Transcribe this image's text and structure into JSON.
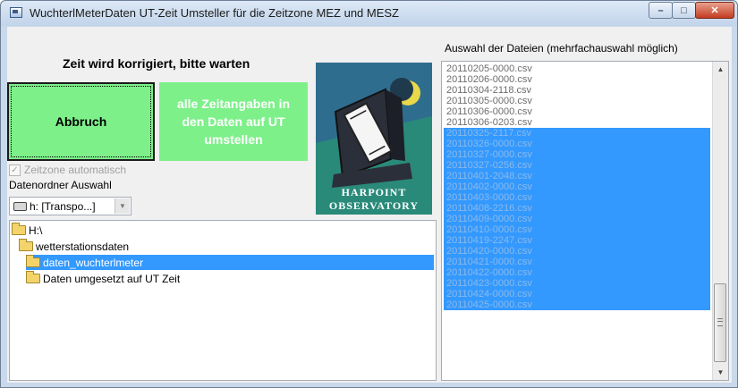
{
  "window": {
    "title": "WuchterlMeterDaten UT-Zeit Umsteller für die Zeitzone MEZ und MESZ",
    "min_label": "–",
    "max_label": "□",
    "close_label": "✕"
  },
  "status": {
    "text": "Zeit wird korrigiert, bitte warten"
  },
  "buttons": {
    "abort_label": "Abbruch",
    "convert_label": "alle Zeitangaben in den Daten auf UT umstellen"
  },
  "timezone_checkbox": {
    "label": "Zeitzone automatisch",
    "checked": true
  },
  "folder": {
    "label": "Datenordner Auswahl",
    "drive_value": "h: [Transpo...]"
  },
  "logo": {
    "line1": "HARPOINT",
    "line2": "OBSERVATORY"
  },
  "directory_tree": [
    {
      "label": "H:\\",
      "selected": false
    },
    {
      "label": "wetterstationsdaten",
      "selected": false
    },
    {
      "label": "daten_wuchterlmeter",
      "selected": true
    },
    {
      "label": "Daten umgesetzt auf UT Zeit",
      "selected": false
    }
  ],
  "files": {
    "label": "Auswahl der Dateien  (mehrfachauswahl möglich)",
    "items": [
      {
        "name": "20110205-0000.csv",
        "selected": false
      },
      {
        "name": "20110206-0000.csv",
        "selected": false
      },
      {
        "name": "20110304-2118.csv",
        "selected": false
      },
      {
        "name": "20110305-0000.csv",
        "selected": false
      },
      {
        "name": "20110306-0000.csv",
        "selected": false
      },
      {
        "name": "20110306-0203.csv",
        "selected": false
      },
      {
        "name": "20110325-2117.csv",
        "selected": true
      },
      {
        "name": "20110326-0000.csv",
        "selected": true
      },
      {
        "name": "20110327-0000.csv",
        "selected": true
      },
      {
        "name": "20110327-0256.csv",
        "selected": true
      },
      {
        "name": "20110401-2048.csv",
        "selected": true
      },
      {
        "name": "20110402-0000.csv",
        "selected": true
      },
      {
        "name": "20110403-0000.csv",
        "selected": true
      },
      {
        "name": "20110408-2216.csv",
        "selected": true
      },
      {
        "name": "20110409-0000.csv",
        "selected": true
      },
      {
        "name": "20110410-0000.csv",
        "selected": true
      },
      {
        "name": "20110419-2247.csv",
        "selected": true
      },
      {
        "name": "20110420-0000.csv",
        "selected": true
      },
      {
        "name": "20110421-0000.csv",
        "selected": true
      },
      {
        "name": "20110422-0000.csv",
        "selected": true
      },
      {
        "name": "20110423-0000.csv",
        "selected": true
      },
      {
        "name": "20110424-0000.csv",
        "selected": true
      },
      {
        "name": "20110425-0000.csv",
        "selected": true
      }
    ]
  }
}
